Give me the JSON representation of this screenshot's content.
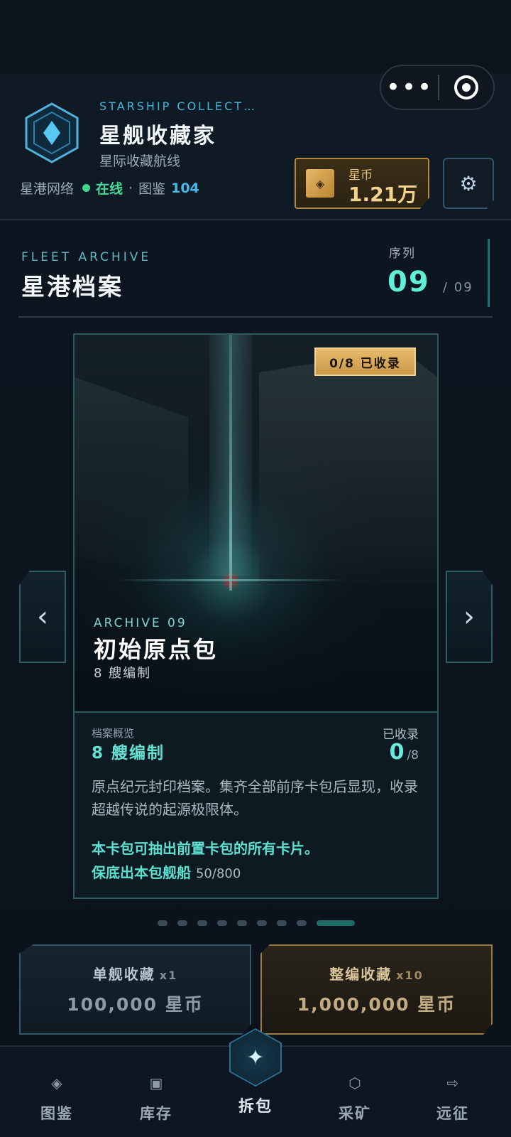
{
  "header": {
    "subtitle_en": "STARSHIP COLLECT…",
    "title": "星舰收藏家",
    "subtitle": "星际收藏航线",
    "network_label": "星港网络",
    "status": "在线",
    "separator": "·",
    "codex_label": "图鉴",
    "codex_count": "104",
    "coin_label": "星币",
    "coin_value": "1.21万",
    "coin_icon": "◈",
    "settings_icon": "⚙"
  },
  "capsule": {
    "more_icon": "•••"
  },
  "archive": {
    "label_en": "FLEET ARCHIVE",
    "title": "星港档案",
    "seq_label": "序列",
    "seq_current": "09",
    "seq_total": "/ 09"
  },
  "card": {
    "badge": "0/8 已收录",
    "code": "ARCHIVE 09",
    "name": "初始原点包",
    "count_text": "8 艘编制",
    "info_label": "档案概览",
    "info_fleet": "8 艘编制",
    "recorded_label": "已收录",
    "recorded_current": "0",
    "recorded_total": "/8",
    "description": "原点纪元封印档案。集齐全部前序卡包后显现，收录超越传说的起源极限体。",
    "highlight_1": "本卡包可抽出前置卡包的所有卡片。",
    "highlight_2_label": "保底出本包舰船",
    "highlight_2_value": "50/800"
  },
  "navigation": {
    "prev": "‹",
    "next": "›"
  },
  "pager": {
    "total": 9,
    "active": 9
  },
  "buy": {
    "single_title": "单舰收藏",
    "single_mult": "x1",
    "single_price": "100,000 星币",
    "fleet_title": "整编收藏",
    "fleet_mult": "x10",
    "fleet_price": "1,000,000 星币"
  },
  "tabs": [
    {
      "label": "图鉴",
      "icon": "◈"
    },
    {
      "label": "库存",
      "icon": "▣"
    },
    {
      "label": "拆包",
      "icon": "✦"
    },
    {
      "label": "采矿",
      "icon": "⬡"
    },
    {
      "label": "远征",
      "icon": "⇨"
    }
  ],
  "colors": {
    "accent": "#61f0d6",
    "gold": "#e7bb6d",
    "bg": "#0b121b"
  }
}
